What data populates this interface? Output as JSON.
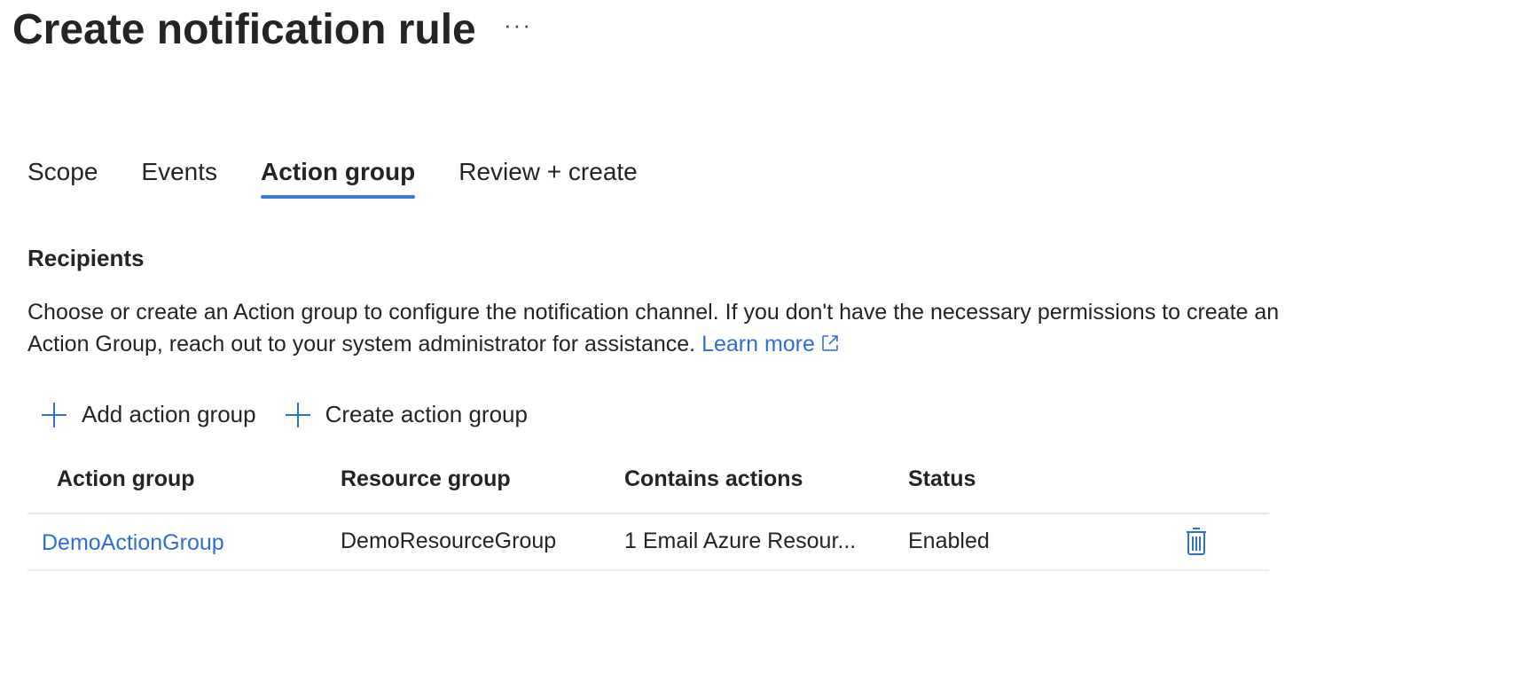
{
  "page": {
    "title": "Create notification rule",
    "more_label": "···"
  },
  "tabs": [
    {
      "label": "Scope",
      "active": false
    },
    {
      "label": "Events",
      "active": false
    },
    {
      "label": "Action group",
      "active": true
    },
    {
      "label": "Review + create",
      "active": false
    }
  ],
  "recipients": {
    "title": "Recipients",
    "description": "Choose or create an Action group to configure the notification channel. If you don't have the necessary permissions to create an Action Group, reach out to your system administrator for assistance.",
    "learn_more": "Learn more"
  },
  "toolbar": {
    "add_label": "Add action group",
    "create_label": "Create action group"
  },
  "table": {
    "columns": [
      "Action group",
      "Resource group",
      "Contains actions",
      "Status"
    ],
    "rows": [
      {
        "action_group": "DemoActionGroup",
        "resource_group": "DemoResourceGroup",
        "contains_actions": "1 Email Azure Resour...",
        "status": "Enabled"
      }
    ]
  },
  "colors": {
    "accent": "#3a7ad8",
    "link": "#2f6fd1",
    "text": "#242424"
  },
  "icons": {
    "more": "ellipsis-icon",
    "external": "external-link-icon",
    "add": "plus-icon",
    "delete": "trash-icon"
  }
}
